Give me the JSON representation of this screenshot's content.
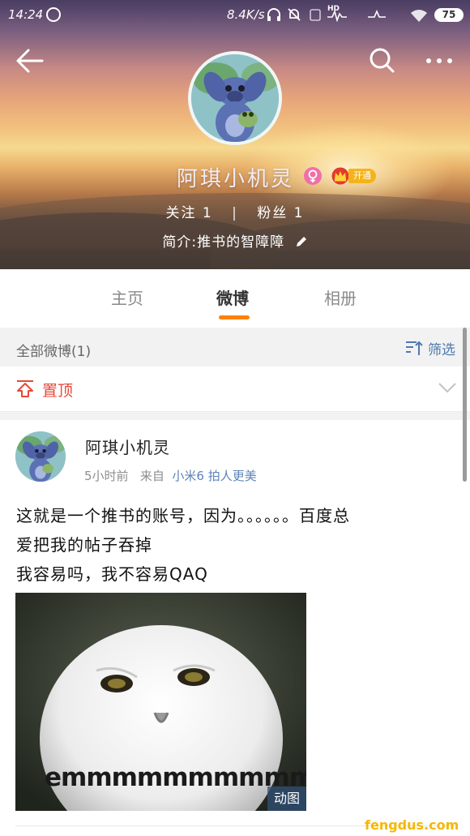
{
  "status_bar": {
    "time": "14:24",
    "net_speed": "8.4K/s",
    "hd": "HD",
    "battery": "75"
  },
  "profile": {
    "name": "阿琪小机灵",
    "vip_label": "开通",
    "following_label": "关注",
    "following_count": "1",
    "followers_label": "粉丝",
    "followers_count": "1",
    "bio": "简介:推书的智障障"
  },
  "tabs": [
    {
      "label": "主页",
      "active": false
    },
    {
      "label": "微博",
      "active": true
    },
    {
      "label": "相册",
      "active": false
    }
  ],
  "filter_bar": {
    "all_label": "全部微博(1)",
    "filter_label": "筛选"
  },
  "pinned": {
    "label": "置顶"
  },
  "post": {
    "author": "阿琪小机灵",
    "time": "5小时前",
    "from": "来自",
    "source": "小米6 拍人更美",
    "text_line1": "这就是一个推书的账号，因为。。。。。。百度总",
    "text_line2": "爱把我的帖子吞掉",
    "text_line3": "我容易吗，我不容易QAQ",
    "image_caption": "emmmmmmmmmm....",
    "gif_label": "动图"
  },
  "watermark": "fengdus.com",
  "colors": {
    "accent": "#ff8200",
    "link": "#5d84ba",
    "pin": "#e5493a",
    "vip": "#f5b31b"
  },
  "icons": [
    "back-arrow-icon",
    "search-icon",
    "more-icon",
    "female-icon",
    "vip-crown-icon",
    "edit-pencil-icon",
    "filter-icon",
    "pin-top-icon",
    "chevron-down-icon"
  ]
}
